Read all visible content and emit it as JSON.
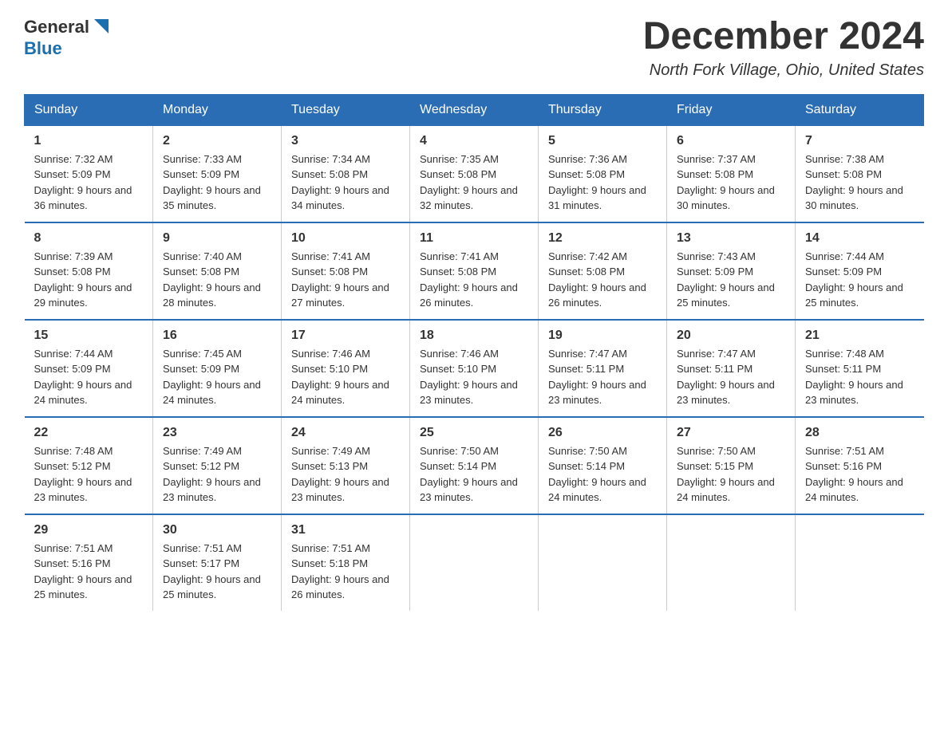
{
  "header": {
    "logo_general": "General",
    "logo_blue": "Blue",
    "month": "December 2024",
    "location": "North Fork Village, Ohio, United States"
  },
  "days_of_week": [
    "Sunday",
    "Monday",
    "Tuesday",
    "Wednesday",
    "Thursday",
    "Friday",
    "Saturday"
  ],
  "weeks": [
    [
      {
        "day": "1",
        "sunrise": "7:32 AM",
        "sunset": "5:09 PM",
        "daylight": "9 hours and 36 minutes."
      },
      {
        "day": "2",
        "sunrise": "7:33 AM",
        "sunset": "5:09 PM",
        "daylight": "9 hours and 35 minutes."
      },
      {
        "day": "3",
        "sunrise": "7:34 AM",
        "sunset": "5:08 PM",
        "daylight": "9 hours and 34 minutes."
      },
      {
        "day": "4",
        "sunrise": "7:35 AM",
        "sunset": "5:08 PM",
        "daylight": "9 hours and 32 minutes."
      },
      {
        "day": "5",
        "sunrise": "7:36 AM",
        "sunset": "5:08 PM",
        "daylight": "9 hours and 31 minutes."
      },
      {
        "day": "6",
        "sunrise": "7:37 AM",
        "sunset": "5:08 PM",
        "daylight": "9 hours and 30 minutes."
      },
      {
        "day": "7",
        "sunrise": "7:38 AM",
        "sunset": "5:08 PM",
        "daylight": "9 hours and 30 minutes."
      }
    ],
    [
      {
        "day": "8",
        "sunrise": "7:39 AM",
        "sunset": "5:08 PM",
        "daylight": "9 hours and 29 minutes."
      },
      {
        "day": "9",
        "sunrise": "7:40 AM",
        "sunset": "5:08 PM",
        "daylight": "9 hours and 28 minutes."
      },
      {
        "day": "10",
        "sunrise": "7:41 AM",
        "sunset": "5:08 PM",
        "daylight": "9 hours and 27 minutes."
      },
      {
        "day": "11",
        "sunrise": "7:41 AM",
        "sunset": "5:08 PM",
        "daylight": "9 hours and 26 minutes."
      },
      {
        "day": "12",
        "sunrise": "7:42 AM",
        "sunset": "5:08 PM",
        "daylight": "9 hours and 26 minutes."
      },
      {
        "day": "13",
        "sunrise": "7:43 AM",
        "sunset": "5:09 PM",
        "daylight": "9 hours and 25 minutes."
      },
      {
        "day": "14",
        "sunrise": "7:44 AM",
        "sunset": "5:09 PM",
        "daylight": "9 hours and 25 minutes."
      }
    ],
    [
      {
        "day": "15",
        "sunrise": "7:44 AM",
        "sunset": "5:09 PM",
        "daylight": "9 hours and 24 minutes."
      },
      {
        "day": "16",
        "sunrise": "7:45 AM",
        "sunset": "5:09 PM",
        "daylight": "9 hours and 24 minutes."
      },
      {
        "day": "17",
        "sunrise": "7:46 AM",
        "sunset": "5:10 PM",
        "daylight": "9 hours and 24 minutes."
      },
      {
        "day": "18",
        "sunrise": "7:46 AM",
        "sunset": "5:10 PM",
        "daylight": "9 hours and 23 minutes."
      },
      {
        "day": "19",
        "sunrise": "7:47 AM",
        "sunset": "5:11 PM",
        "daylight": "9 hours and 23 minutes."
      },
      {
        "day": "20",
        "sunrise": "7:47 AM",
        "sunset": "5:11 PM",
        "daylight": "9 hours and 23 minutes."
      },
      {
        "day": "21",
        "sunrise": "7:48 AM",
        "sunset": "5:11 PM",
        "daylight": "9 hours and 23 minutes."
      }
    ],
    [
      {
        "day": "22",
        "sunrise": "7:48 AM",
        "sunset": "5:12 PM",
        "daylight": "9 hours and 23 minutes."
      },
      {
        "day": "23",
        "sunrise": "7:49 AM",
        "sunset": "5:12 PM",
        "daylight": "9 hours and 23 minutes."
      },
      {
        "day": "24",
        "sunrise": "7:49 AM",
        "sunset": "5:13 PM",
        "daylight": "9 hours and 23 minutes."
      },
      {
        "day": "25",
        "sunrise": "7:50 AM",
        "sunset": "5:14 PM",
        "daylight": "9 hours and 23 minutes."
      },
      {
        "day": "26",
        "sunrise": "7:50 AM",
        "sunset": "5:14 PM",
        "daylight": "9 hours and 24 minutes."
      },
      {
        "day": "27",
        "sunrise": "7:50 AM",
        "sunset": "5:15 PM",
        "daylight": "9 hours and 24 minutes."
      },
      {
        "day": "28",
        "sunrise": "7:51 AM",
        "sunset": "5:16 PM",
        "daylight": "9 hours and 24 minutes."
      }
    ],
    [
      {
        "day": "29",
        "sunrise": "7:51 AM",
        "sunset": "5:16 PM",
        "daylight": "9 hours and 25 minutes."
      },
      {
        "day": "30",
        "sunrise": "7:51 AM",
        "sunset": "5:17 PM",
        "daylight": "9 hours and 25 minutes."
      },
      {
        "day": "31",
        "sunrise": "7:51 AM",
        "sunset": "5:18 PM",
        "daylight": "9 hours and 26 minutes."
      },
      {
        "day": "",
        "sunrise": "",
        "sunset": "",
        "daylight": ""
      },
      {
        "day": "",
        "sunrise": "",
        "sunset": "",
        "daylight": ""
      },
      {
        "day": "",
        "sunrise": "",
        "sunset": "",
        "daylight": ""
      },
      {
        "day": "",
        "sunrise": "",
        "sunset": "",
        "daylight": ""
      }
    ]
  ],
  "labels": {
    "sunrise_prefix": "Sunrise: ",
    "sunset_prefix": "Sunset: ",
    "daylight_prefix": "Daylight: "
  }
}
